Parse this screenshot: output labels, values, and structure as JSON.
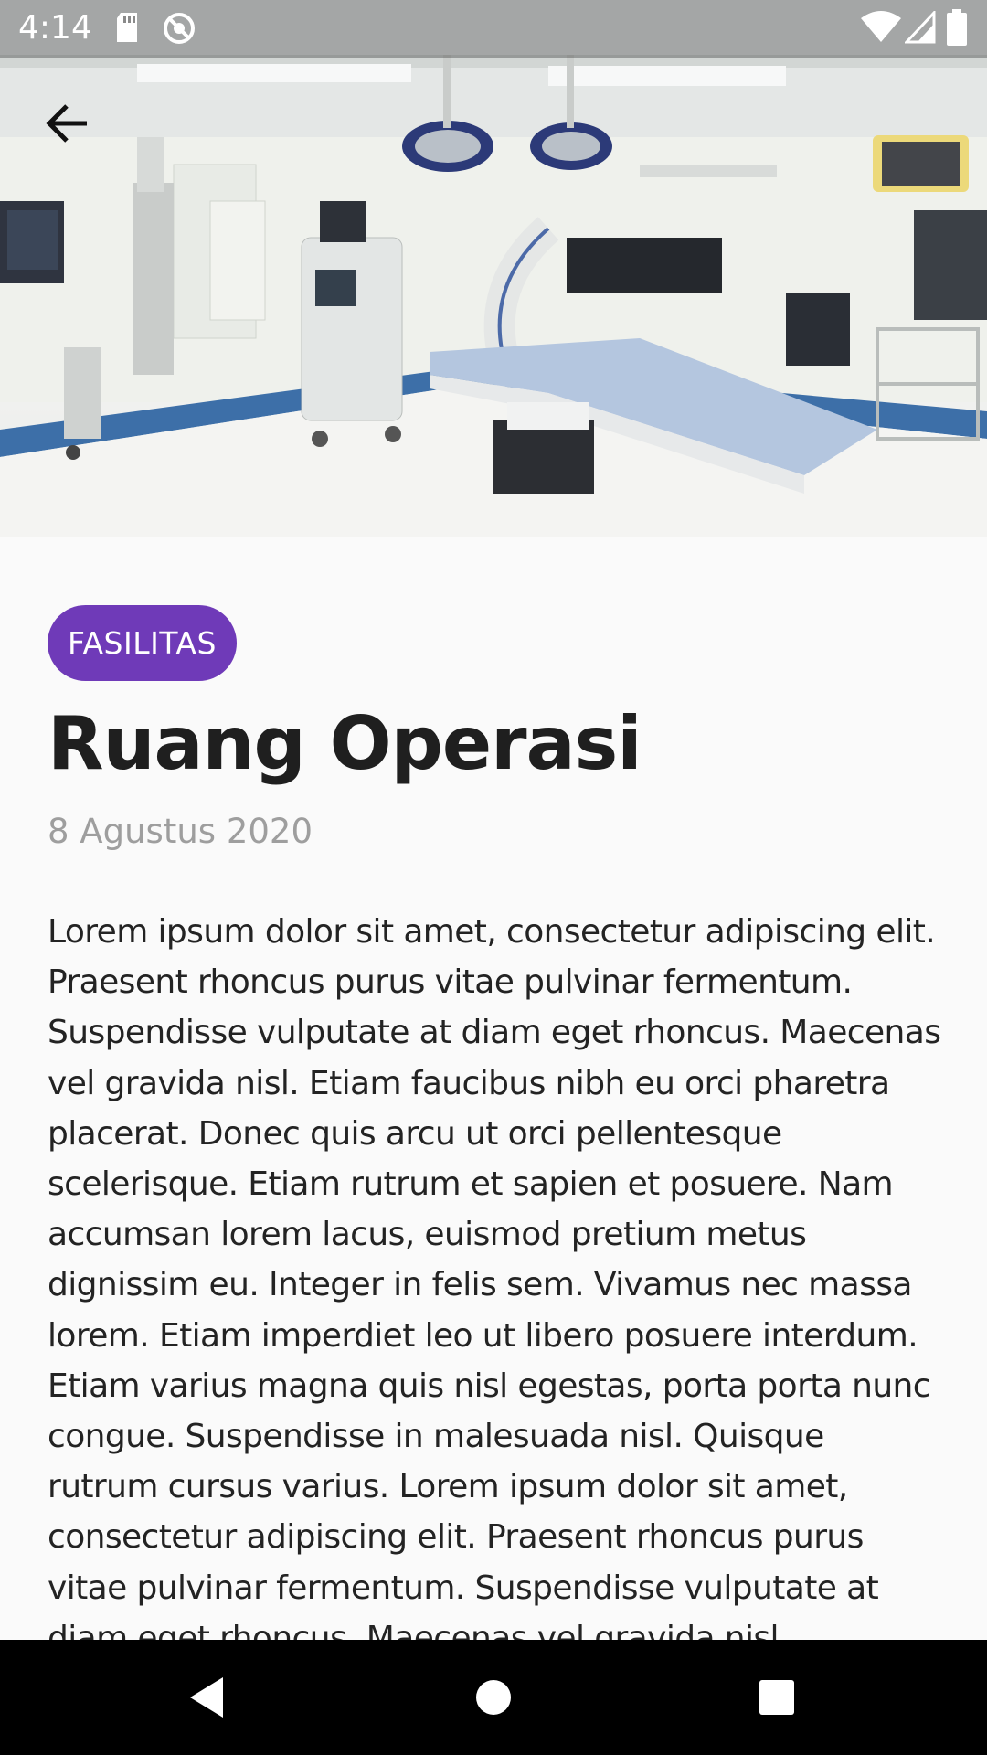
{
  "status_bar": {
    "time": "4:14",
    "icons": [
      "sd-card-icon",
      "sync-disabled-icon",
      "wifi-icon",
      "signal-icon",
      "battery-icon"
    ]
  },
  "hero": {
    "image": "operating-room-photo",
    "back_icon": "arrow-back-icon"
  },
  "article": {
    "category": "FASILITAS",
    "title": "Ruang Operasi",
    "date": "8 Agustus 2020",
    "body": "Lorem ipsum dolor sit amet, consectetur adipiscing elit. Praesent rhoncus purus vitae pulvinar fermentum. Suspendisse vulputate at diam eget rhoncus. Maecenas vel gravida nisl. Etiam faucibus nibh eu orci pharetra placerat. Donec quis arcu ut orci pellentesque scelerisque. Etiam rutrum et sapien et posuere. Nam accumsan lorem lacus, euismod pretium metus dignissim eu. Integer in felis sem. Vivamus nec massa lorem. Etiam imperdiet leo ut libero posuere interdum. Etiam varius magna quis nisl egestas, porta porta nunc congue. Suspendisse in malesuada nisl. Quisque rutrum cursus varius. Lorem ipsum dolor sit amet, consectetur adipiscing elit. Praesent rhoncus purus vitae pulvinar fermentum. Suspendisse vulputate at diam eget rhoncus. Maecenas vel gravida nisl."
  },
  "colors": {
    "accent": "#6f3ab8",
    "title": "#1f1f1f",
    "date": "#9e9e9e",
    "background": "#fafafa"
  },
  "nav_bar": {
    "icons": [
      "back-triangle-icon",
      "home-circle-icon",
      "recents-square-icon"
    ]
  }
}
